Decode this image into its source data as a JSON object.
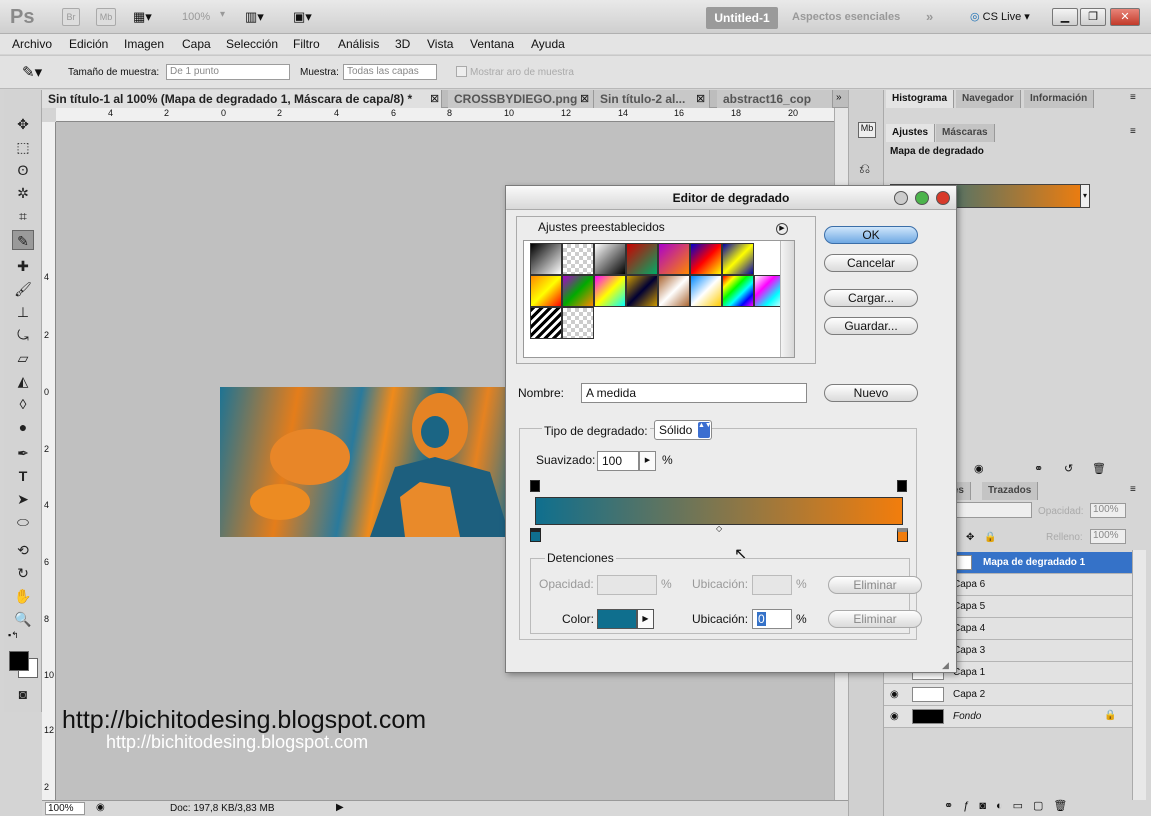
{
  "app": {
    "logo": "Ps",
    "btn_br": "Br",
    "btn_mb": "Mb",
    "zoom": "100%",
    "workspace_doc": "Untitled-1",
    "workspace_name": "Aspectos esenciales",
    "cs_live": "CS Live"
  },
  "menu": [
    "Archivo",
    "Edición",
    "Imagen",
    "Capa",
    "Selección",
    "Filtro",
    "Análisis",
    "3D",
    "Vista",
    "Ventana",
    "Ayuda"
  ],
  "options": {
    "sample_size_label": "Tamaño de muestra:",
    "sample_size_value": "De 1 punto",
    "sample_label": "Muestra:",
    "sample_value": "Todas las capas",
    "show_ring_label": "Mostrar aro de muestra"
  },
  "doc_tabs": [
    "Sin título-1 al 100% (Mapa de degradado 1, Máscara de capa/8) *",
    "CROSSBYDIEGO.png",
    "Sin título-2 al...",
    "abstract16_cop"
  ],
  "ruler_h": [
    "4",
    "2",
    "0",
    "2",
    "4",
    "6",
    "8",
    "10",
    "12",
    "14",
    "16",
    "18",
    "20"
  ],
  "ruler_v": [
    "4",
    "2",
    "0",
    "2",
    "4",
    "6",
    "8",
    "10",
    "12",
    "2"
  ],
  "watermark": "http://bichitodesing.blogspot.com",
  "status": {
    "zoom": "100%",
    "doc": "Doc: 197,8 KB/3,83 MB"
  },
  "panels": {
    "top_tabs": [
      "Histograma",
      "Navegador",
      "Información"
    ],
    "adj_tabs": [
      "Ajustes",
      "Máscaras"
    ],
    "adj_title": "Mapa de degradado",
    "layer_tabs": [
      "les",
      "Trazados"
    ],
    "opacity_label": "Opacidad:",
    "opacity_value": "100%",
    "fill_label": "Relleno:",
    "fill_value": "100%",
    "layers": [
      {
        "name": "Mapa de degradado 1",
        "selected": true
      },
      {
        "name": "Capa 6"
      },
      {
        "name": "Capa 5"
      },
      {
        "name": "Capa 4"
      },
      {
        "name": "Capa 3"
      },
      {
        "name": "Capa 1"
      },
      {
        "name": "Capa 2"
      },
      {
        "name": "Fondo"
      }
    ]
  },
  "dialog": {
    "title": "Editor de degradado",
    "presets_label": "Ajustes preestablecidos",
    "ok": "OK",
    "cancel": "Cancelar",
    "load": "Cargar...",
    "save": "Guardar...",
    "name_label": "Nombre:",
    "name_value": "A medida",
    "new": "Nuevo",
    "type_label": "Tipo de degradado:",
    "type_value": "Sólido",
    "smooth_label": "Suavizado:",
    "smooth_value": "100",
    "percent": "%",
    "stops_label": "Detenciones",
    "opacity_label": "Opacidad:",
    "location_label": "Ubicación:",
    "delete": "Eliminar",
    "color_label": "Color:",
    "location_value": "0",
    "gradient_start": "#0f6f8e",
    "gradient_end": "#f27d0c"
  }
}
